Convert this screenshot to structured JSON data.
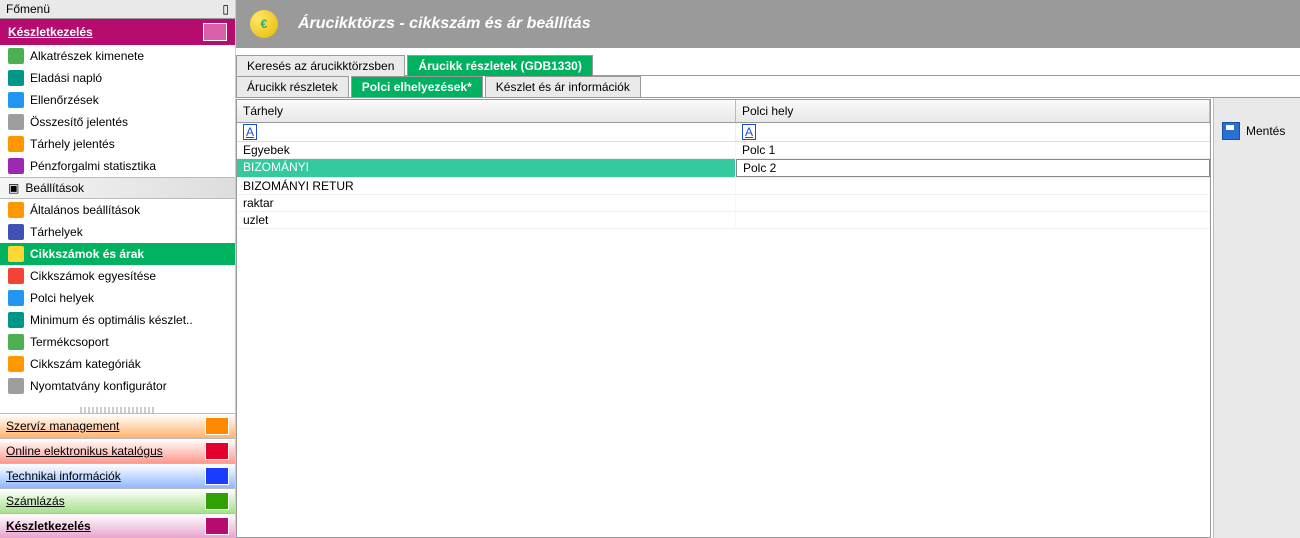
{
  "sidebar": {
    "mainmenu_label": "Főmenü",
    "section_title": "Készletkezelés",
    "items": [
      {
        "label": "Alkatrészek kimenete",
        "iconColor": "ic-green"
      },
      {
        "label": "Eladási napló",
        "iconColor": "ic-teal"
      },
      {
        "label": "Ellenőrzések",
        "iconColor": "ic-blue"
      },
      {
        "label": "Összesítő jelentés",
        "iconColor": "ic-gray"
      },
      {
        "label": "Tárhely jelentés",
        "iconColor": "ic-orange"
      },
      {
        "label": "Pénzforgalmi statisztika",
        "iconColor": "ic-purple"
      }
    ],
    "group_label": "Beállítások",
    "settings_items": [
      {
        "label": "Általános beállítások",
        "iconColor": "ic-orange"
      },
      {
        "label": "Tárhelyek",
        "iconColor": "ic-navy"
      },
      {
        "label": "Cikkszámok és árak",
        "iconColor": "ic-yellow",
        "active": true
      },
      {
        "label": "Cikkszámok egyesítése",
        "iconColor": "ic-red"
      },
      {
        "label": "Polci helyek",
        "iconColor": "ic-blue"
      },
      {
        "label": "Minimum és optimális készlet..",
        "iconColor": "ic-teal"
      },
      {
        "label": "Termékcsoport",
        "iconColor": "ic-green"
      },
      {
        "label": "Cikkszám kategóriák",
        "iconColor": "ic-orange"
      },
      {
        "label": "Nyomtatvány konfigurátor",
        "iconColor": "ic-gray"
      }
    ],
    "bottom_bars": [
      {
        "label": "Szervíz management",
        "cls": "orange"
      },
      {
        "label": "Online elektronikus katalógus",
        "cls": "red"
      },
      {
        "label": "Technikai információk",
        "cls": "blue"
      },
      {
        "label": "Számlázás",
        "cls": "green"
      },
      {
        "label": "Készletkezelés",
        "cls": "magenta"
      }
    ]
  },
  "header": {
    "title": "Árucikktörzs - cikkszám és ár beállítás"
  },
  "tabs": [
    {
      "label": "Keresés az árucikktörzsben",
      "active": false
    },
    {
      "label": "Árucikk részletek (GDB1330)",
      "active": true
    }
  ],
  "subtabs": [
    {
      "label": "Árucikk részletek",
      "active": false
    },
    {
      "label": "Polci elhelyezések*",
      "active": true
    },
    {
      "label": "Készlet és ár információk",
      "active": false
    }
  ],
  "table": {
    "columns": [
      "Tárhely",
      "Polci hely"
    ],
    "filter_glyph": "A",
    "rows": [
      {
        "c0": "Egyebek",
        "c1": "Polc 1"
      },
      {
        "c0": "BIZOMÁNYI",
        "c1": "Polc 2",
        "selected": true,
        "editing": true
      },
      {
        "c0": "BIZOMÁNYI RETUR",
        "c1": ""
      },
      {
        "c0": "raktar",
        "c1": ""
      },
      {
        "c0": "uzlet",
        "c1": ""
      }
    ]
  },
  "actions": {
    "save_label": "Mentés"
  }
}
